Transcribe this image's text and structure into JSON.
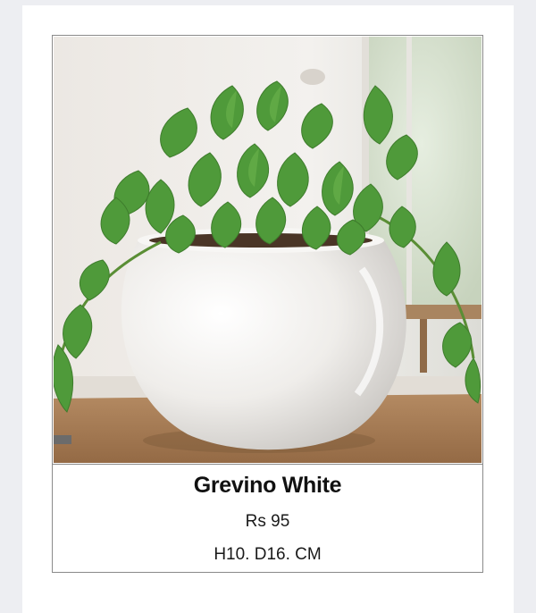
{
  "product": {
    "name": "Grevino White",
    "price": "Rs 95",
    "dimensions": "H10. D16. CM",
    "image_icon": "potted-plant-photo",
    "pot_color": "#f2f0ee",
    "leaf_color": "#4f9a3a"
  }
}
